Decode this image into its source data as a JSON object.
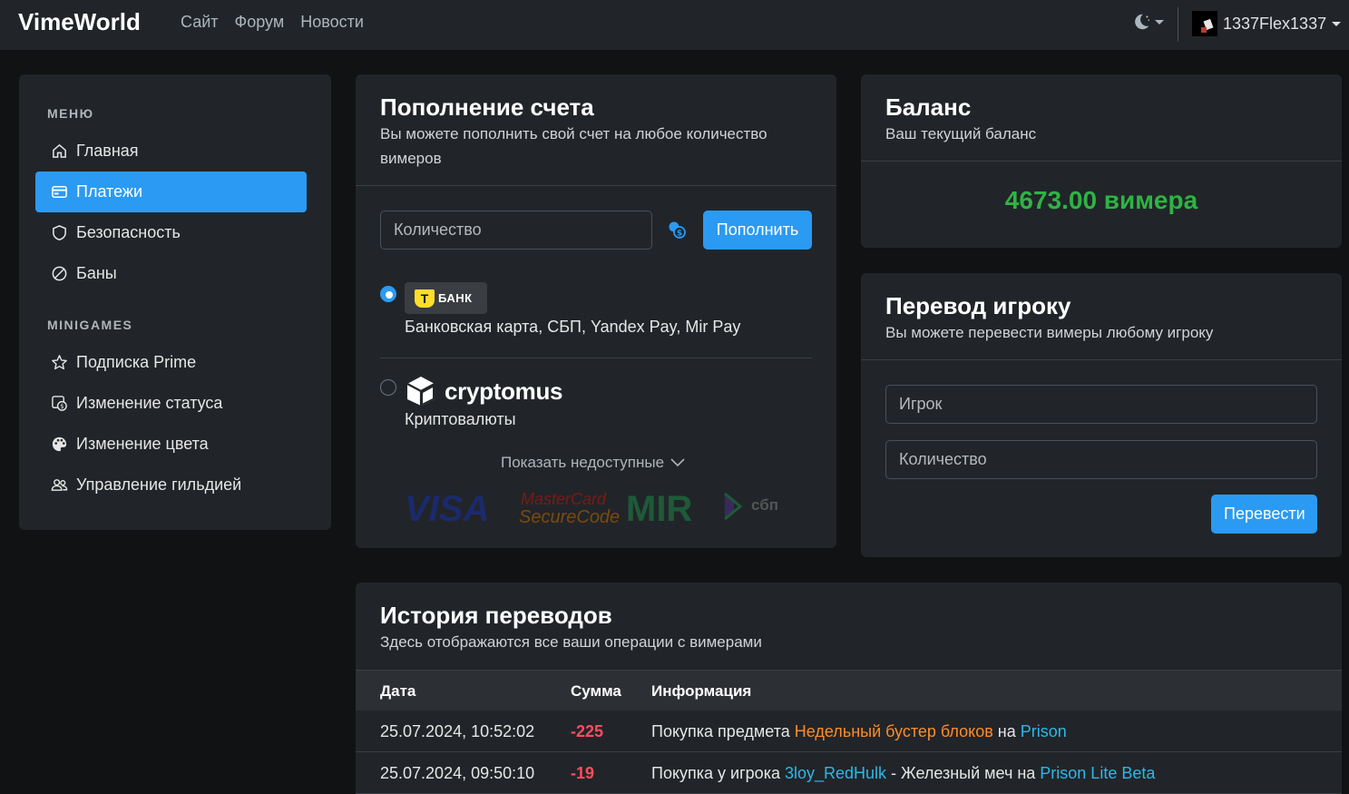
{
  "navbar": {
    "brand": "VimeWorld",
    "links": [
      "Сайт",
      "Форум",
      "Новости"
    ],
    "username": "1337Flex1337"
  },
  "sidebar": {
    "menu_heading": "МЕНЮ",
    "menu_items": [
      {
        "label": "Главная",
        "icon": "home-icon"
      },
      {
        "label": "Платежи",
        "icon": "credit-card-icon",
        "active": true
      },
      {
        "label": "Безопасность",
        "icon": "shield-icon"
      },
      {
        "label": "Баны",
        "icon": "ban-icon"
      }
    ],
    "minigames_heading": "MINIGAMES",
    "minigames_items": [
      {
        "label": "Подписка Prime",
        "icon": "star-icon"
      },
      {
        "label": "Изменение статуса",
        "icon": "status-coins-icon"
      },
      {
        "label": "Изменение цвета",
        "icon": "palette-icon"
      },
      {
        "label": "Управление гильдией",
        "icon": "people-icon"
      }
    ]
  },
  "topup": {
    "title": "Пополнение счета",
    "subtitle": "Вы можете пополнить свой счет на любое количество вимеров",
    "amount_placeholder": "Количество",
    "submit_label": "Пополнить",
    "methods": [
      {
        "logo_text": "БАНК",
        "logo_letter": "T",
        "description": "Банковская карта, СБП, Yandex Pay, Mir Pay",
        "selected": true
      },
      {
        "logo_text": "cryptomus",
        "description": "Криптовалюты",
        "selected": false
      }
    ],
    "show_unavailable": "Показать недоступные",
    "brand_logos": [
      "VISA",
      "MasterCard",
      "SecureCode",
      "MIR",
      "сбп"
    ]
  },
  "balance": {
    "title": "Баланс",
    "subtitle": "Ваш текущий баланс",
    "value": "4673.00 вимера"
  },
  "transfer": {
    "title": "Перевод игроку",
    "subtitle": "Вы можете перевести вимеры любому игроку",
    "player_placeholder": "Игрок",
    "amount_placeholder": "Количество",
    "submit_label": "Перевести"
  },
  "history": {
    "title": "История переводов",
    "subtitle": "Здесь отображаются все ваши операции с вимерами",
    "columns": [
      "Дата",
      "Сумма",
      "Информация"
    ],
    "rows": [
      {
        "date": "25.07.2024, 10:52:02",
        "amount": "-225",
        "info_prefix": "Покупка предмета ",
        "info_item": "Недельный бустер блоков",
        "info_mid": " на ",
        "info_server": "Prison"
      },
      {
        "date": "25.07.2024, 09:50:10",
        "amount": "-19",
        "info_prefix": "Покупка у игрока ",
        "info_player": "3loy_RedHulk",
        "info_mid": " - Железный меч на ",
        "info_server": "Prison Lite Beta"
      }
    ]
  },
  "colors": {
    "accent": "#2b9af3",
    "balance": "#2fb344",
    "negative": "#ff4d5e",
    "item": "#fd8c2a",
    "server": "#2cb8e8"
  }
}
